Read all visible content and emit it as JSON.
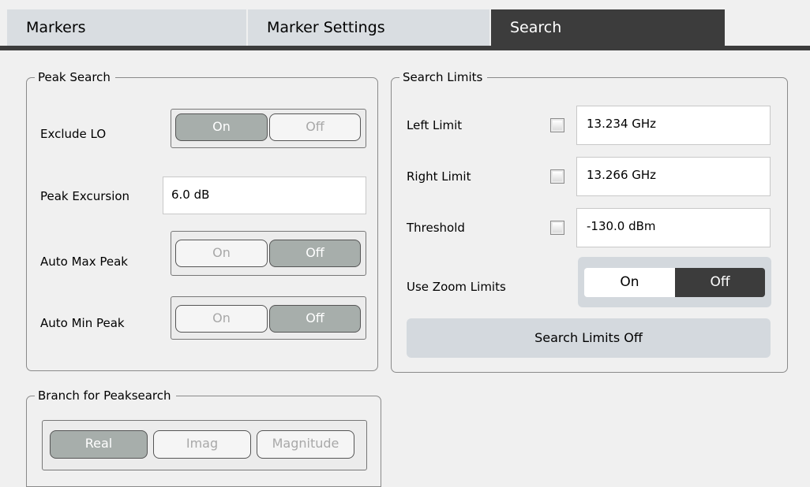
{
  "tabs": [
    {
      "label": "Markers"
    },
    {
      "label": "Marker Settings"
    },
    {
      "label": "Search"
    }
  ],
  "peak_search": {
    "title": "Peak Search",
    "exclude_lo": {
      "label": "Exclude LO",
      "on": "On",
      "off": "Off",
      "selected": "On"
    },
    "peak_excursion": {
      "label": "Peak Excursion",
      "value": "6.0 dB"
    },
    "auto_max_peak": {
      "label": "Auto Max Peak",
      "on": "On",
      "off": "Off",
      "selected": "Off"
    },
    "auto_min_peak": {
      "label": "Auto Min Peak",
      "on": "On",
      "off": "Off",
      "selected": "Off"
    }
  },
  "search_limits": {
    "title": "Search Limits",
    "left_limit": {
      "label": "Left Limit",
      "value": "13.234 GHz",
      "checked": false
    },
    "right_limit": {
      "label": "Right Limit",
      "value": "13.266 GHz",
      "checked": false
    },
    "threshold": {
      "label": "Threshold",
      "value": "-130.0 dBm",
      "checked": false
    },
    "use_zoom_limits": {
      "label": "Use Zoom Limits",
      "on": "On",
      "off": "Off",
      "selected": "Off"
    },
    "off_button": "Search Limits Off"
  },
  "branch": {
    "title": "Branch for Peaksearch",
    "options": [
      "Real",
      "Imag",
      "Magnitude"
    ],
    "selected": "Real"
  }
}
